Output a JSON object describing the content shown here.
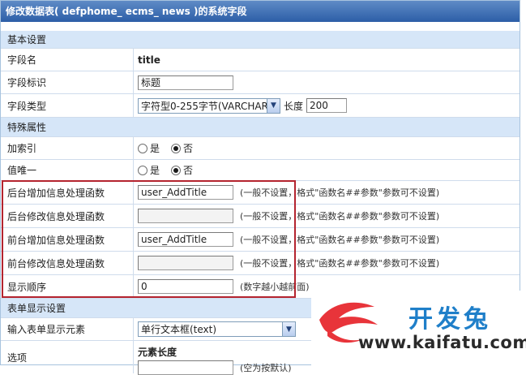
{
  "title": "修改数据表( defphome_ ecms_ news )的系统字段",
  "sections": {
    "basic": "基本设置",
    "special": "特殊属性",
    "form": "表单显示设置"
  },
  "fields": {
    "field_name_label": "字段名",
    "field_name_value": "title",
    "field_mark_label": "字段标识",
    "field_mark_value": "标题",
    "field_type_label": "字段类型",
    "field_type_value": "字符型0-255字节(VARCHAR)",
    "length_label": "长度",
    "length_value": "200",
    "index_label": "加索引",
    "unique_label": "值唯一",
    "radio_yes": "是",
    "radio_no": "否",
    "back_add_label": "后台增加信息处理函数",
    "back_add_value": "user_AddTitle",
    "back_edit_label": "后台修改信息处理函数",
    "back_edit_value": "",
    "front_add_label": "前台增加信息处理函数",
    "front_add_value": "user_AddTitle",
    "front_edit_label": "前台修改信息处理函数",
    "front_edit_value": "",
    "func_hint": "(一般不设置，格式\"函数名##参数\"参数可不设置)",
    "order_label": "显示顺序",
    "order_value": "0",
    "order_hint": "(数字越小越前面)",
    "input_element_label": "输入表单显示元素",
    "input_element_value": "单行文本框(text)",
    "options_label": "选项",
    "element_length_label": "元素长度",
    "element_length_hint": "(空为按默认)"
  },
  "watermark": {
    "brand": "开发兔",
    "url": "www.kaifatu.com"
  },
  "colors": {
    "title_bar": "#2c5ea7",
    "section_bg": "#d6e6f8",
    "highlight_border": "#b4242f",
    "watermark_blue": "#1f7fc9",
    "watermark_red": "#e8343a"
  }
}
